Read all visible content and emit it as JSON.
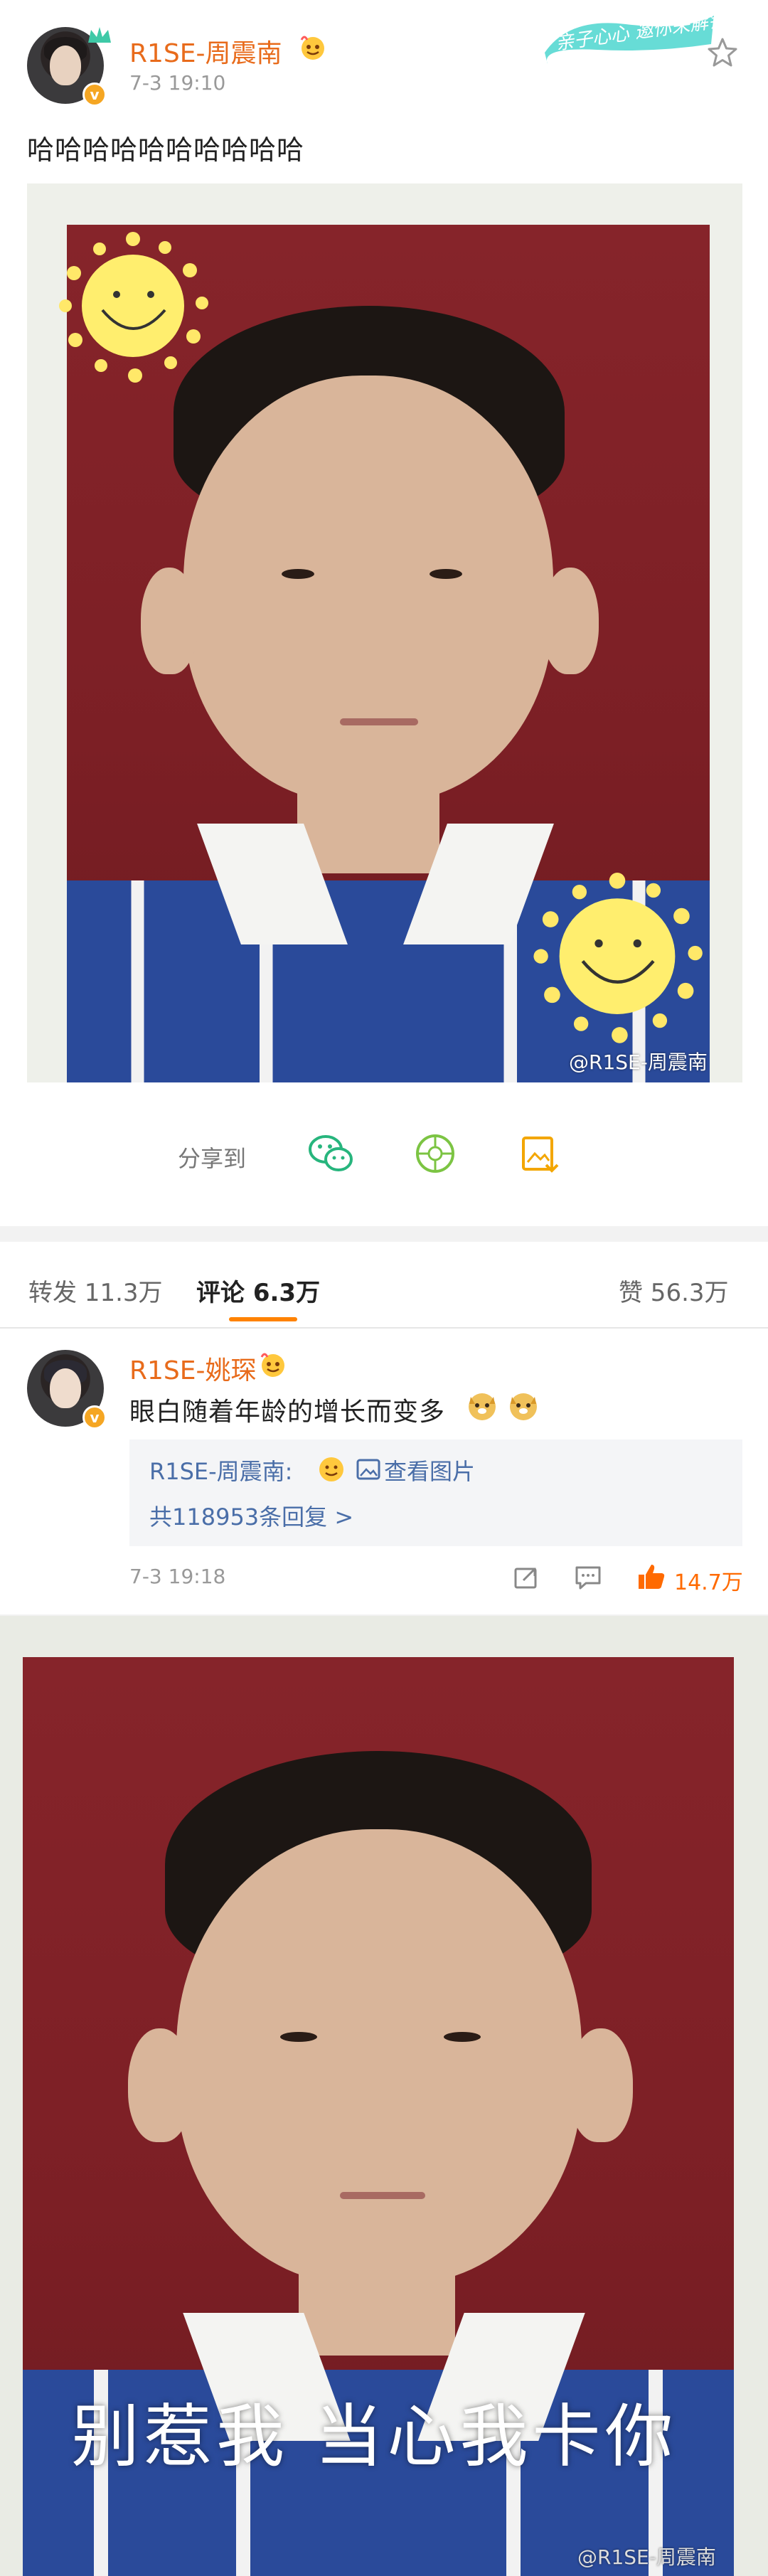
{
  "post": {
    "username": "R1SE-周震南",
    "time": "7-3 19:10",
    "text": "哈哈哈哈哈哈哈哈哈哈",
    "watermark": "@R1SE-周震南",
    "topic_sticker": "亲子心心 邀你来解锁"
  },
  "share": {
    "label": "分享到",
    "targets": [
      "wechat-icon",
      "moments-icon",
      "save-image-icon"
    ]
  },
  "tabs": {
    "repost": "转发 11.3万",
    "comments": "评论 6.3万",
    "likes": "赞 56.3万"
  },
  "comment": {
    "username": "R1SE-姚琛",
    "text": "眼白随着年龄的增长而变多",
    "emoji": "doge-emoji",
    "reply_author": "R1SE-周震南:",
    "reply_view_image": "查看图片",
    "reply_count": "共118953条回复 >",
    "time": "7-3 19:18",
    "like_count": "14.7万"
  },
  "image2": {
    "caption": "别惹我 当心我卡你",
    "watermark": "@R1SE-周震南"
  },
  "colors": {
    "username": "#e86b1b",
    "accent": "#ff8200",
    "like": "#ff6a00",
    "link": "#4a6ea8"
  }
}
